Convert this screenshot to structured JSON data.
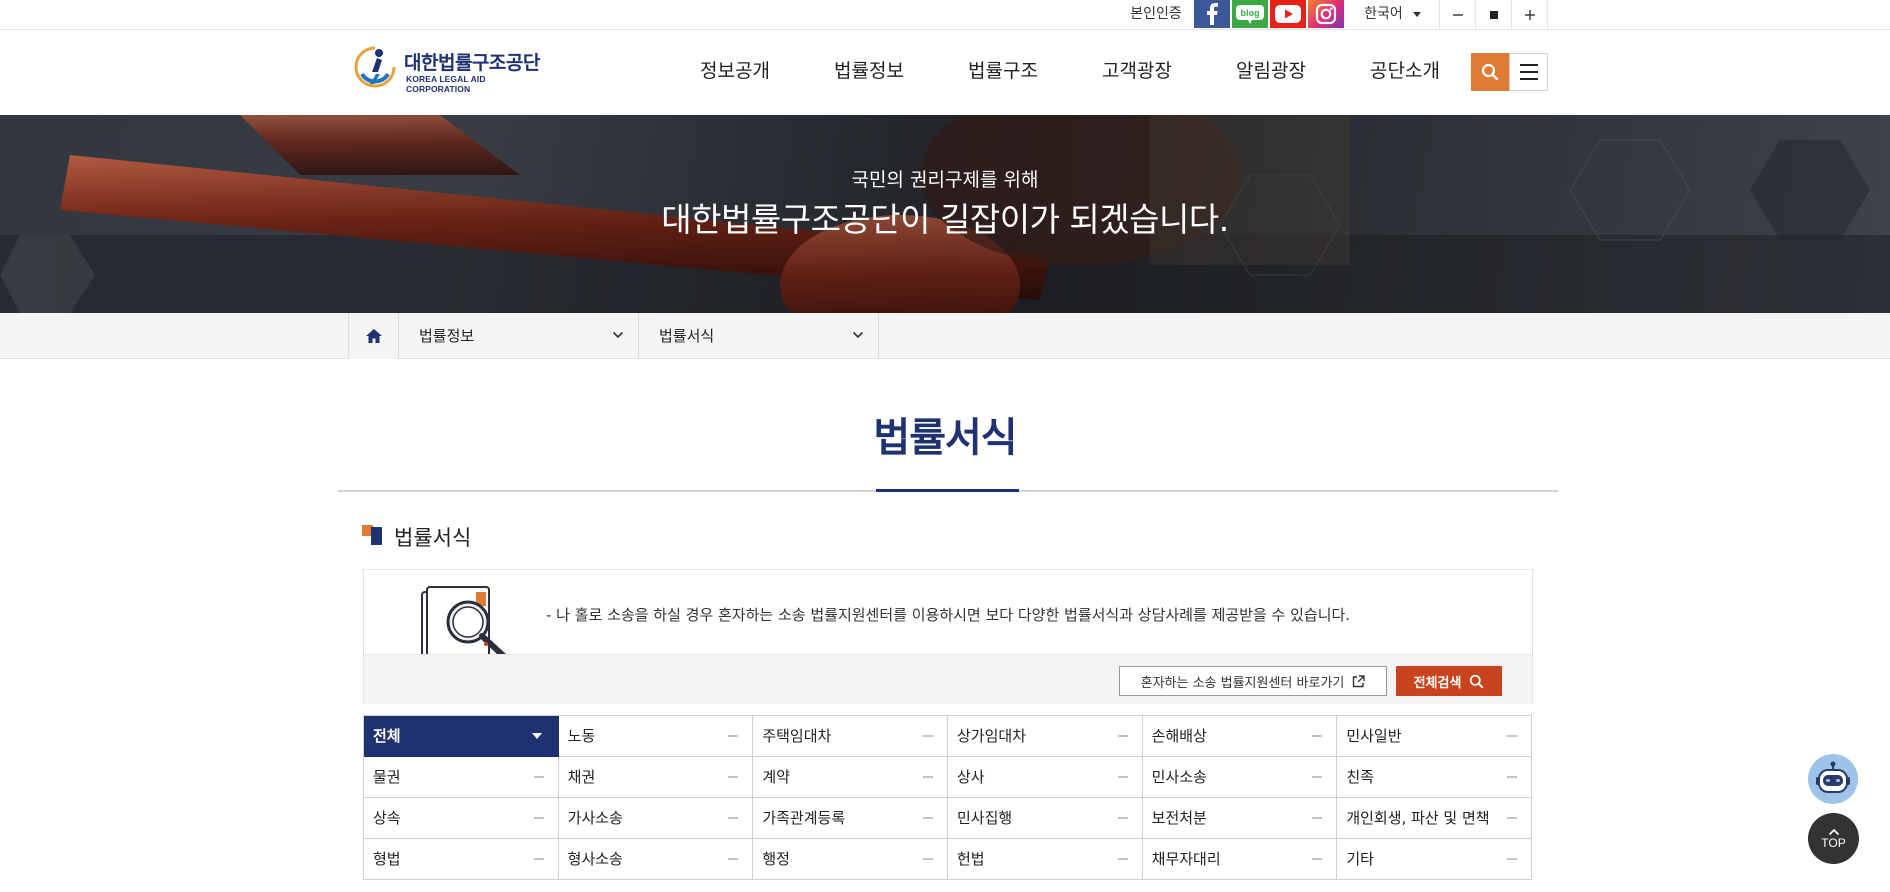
{
  "utility": {
    "verify_label": "본인인증",
    "social": [
      {
        "name": "facebook",
        "label": "f"
      },
      {
        "name": "blog",
        "label": "blog"
      },
      {
        "name": "youtube",
        "label": ""
      },
      {
        "name": "instagram",
        "label": ""
      }
    ],
    "language": "한국어",
    "zoom": [
      "−",
      "■",
      "+"
    ]
  },
  "header": {
    "logo_ko": "대한법률구조공단",
    "logo_en": "KOREA LEGAL AID CORPORATION",
    "nav": [
      "정보공개",
      "법률정보",
      "법률구조",
      "고객광장",
      "알림광장",
      "공단소개"
    ]
  },
  "hero": {
    "subtitle": "국민의 권리구제를 위해",
    "title": "대한법률구조공단이 길잡이가 되겠습니다."
  },
  "location": {
    "depth1": "법률정보",
    "depth2": "법률서식"
  },
  "page": {
    "title": "법률서식",
    "section_title": "법률서식"
  },
  "info": {
    "description": "- 나 홀로 소송을 하실 경우 혼자하는 소송 법률지원센터를 이용하시면 보다 다양한 법률서식과 상담사례를 제공받을 수 있습니다.",
    "link_button": "혼자하는 소송 법률지원센터 바로가기",
    "search_button": "전체검색"
  },
  "categories": [
    "전체",
    "노동",
    "주택임대차",
    "상가임대차",
    "손해배상",
    "민사일반",
    "물권",
    "채권",
    "계약",
    "상사",
    "민사소송",
    "친족",
    "상속",
    "가사소송",
    "가족관계등록",
    "민사집행",
    "보전처분",
    "개인회생, 파산 및 면책",
    "형법",
    "형사소송",
    "행정",
    "헌법",
    "채무자대리",
    "기타"
  ],
  "active_category": "전체",
  "floating": {
    "top_label": "TOP"
  },
  "colors": {
    "brand_navy": "#1e3170",
    "accent_orange": "#e07b33",
    "search_red": "#c8441f"
  }
}
